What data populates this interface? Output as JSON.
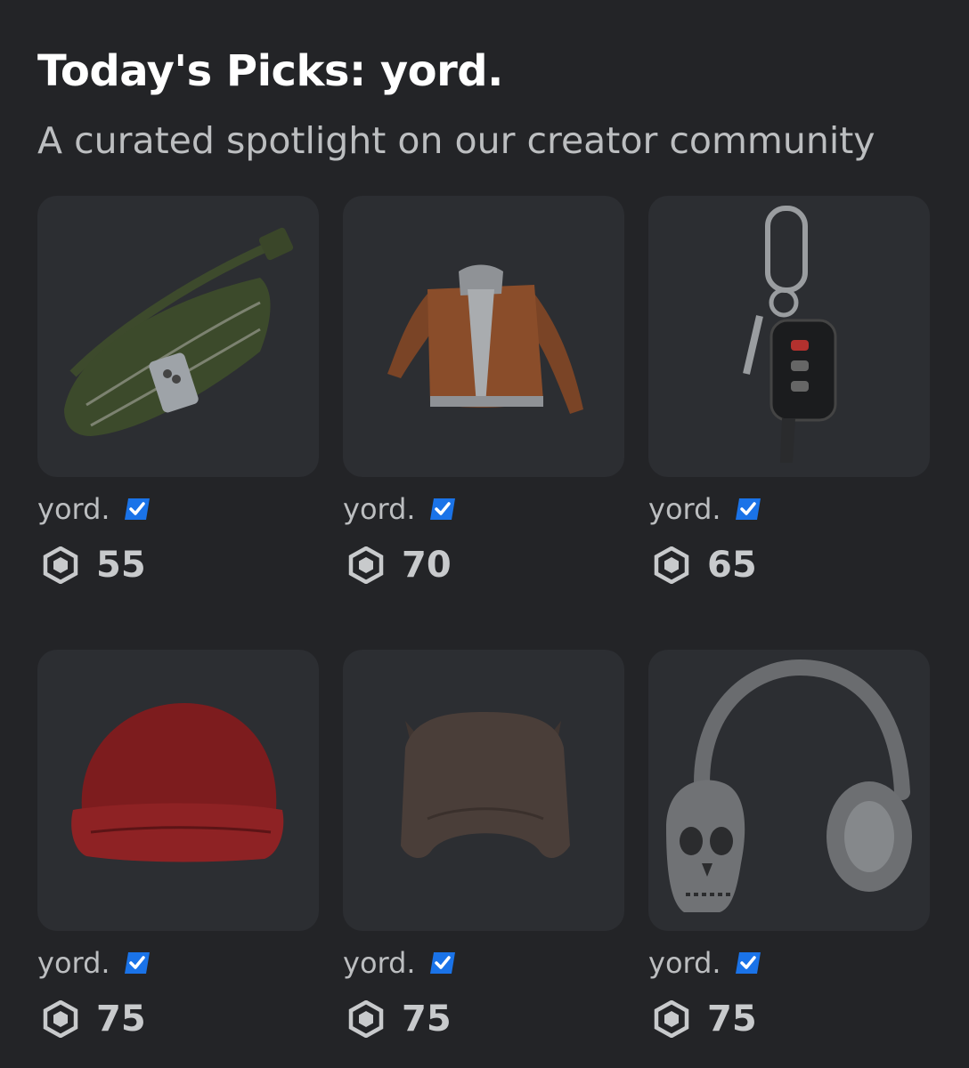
{
  "header": {
    "title": "Today's Picks: yord.",
    "subtitle": "A curated spotlight on our creator community"
  },
  "currency_icon": "robux-icon",
  "verified_icon": "verified-badge-icon",
  "colors": {
    "background": "#232427",
    "card": "#2c2e32",
    "verified": "#1a73e8",
    "muted_text": "#bcbec0"
  },
  "items": [
    {
      "image": "olive-fanny-pack-with-phone",
      "creator": "yord.",
      "price": "55"
    },
    {
      "image": "brown-leather-jacket-with-grey-hood",
      "creator": "yord.",
      "price": "70"
    },
    {
      "image": "car-key-fob-keychain-carabiner",
      "creator": "yord.",
      "price": "65"
    },
    {
      "image": "red-houndstooth-beanie",
      "creator": "yord.",
      "price": "75"
    },
    {
      "image": "brown-cat-ear-hood",
      "creator": "yord.",
      "price": "75"
    },
    {
      "image": "skull-over-ear-headphones",
      "creator": "yord.",
      "price": "75"
    }
  ]
}
